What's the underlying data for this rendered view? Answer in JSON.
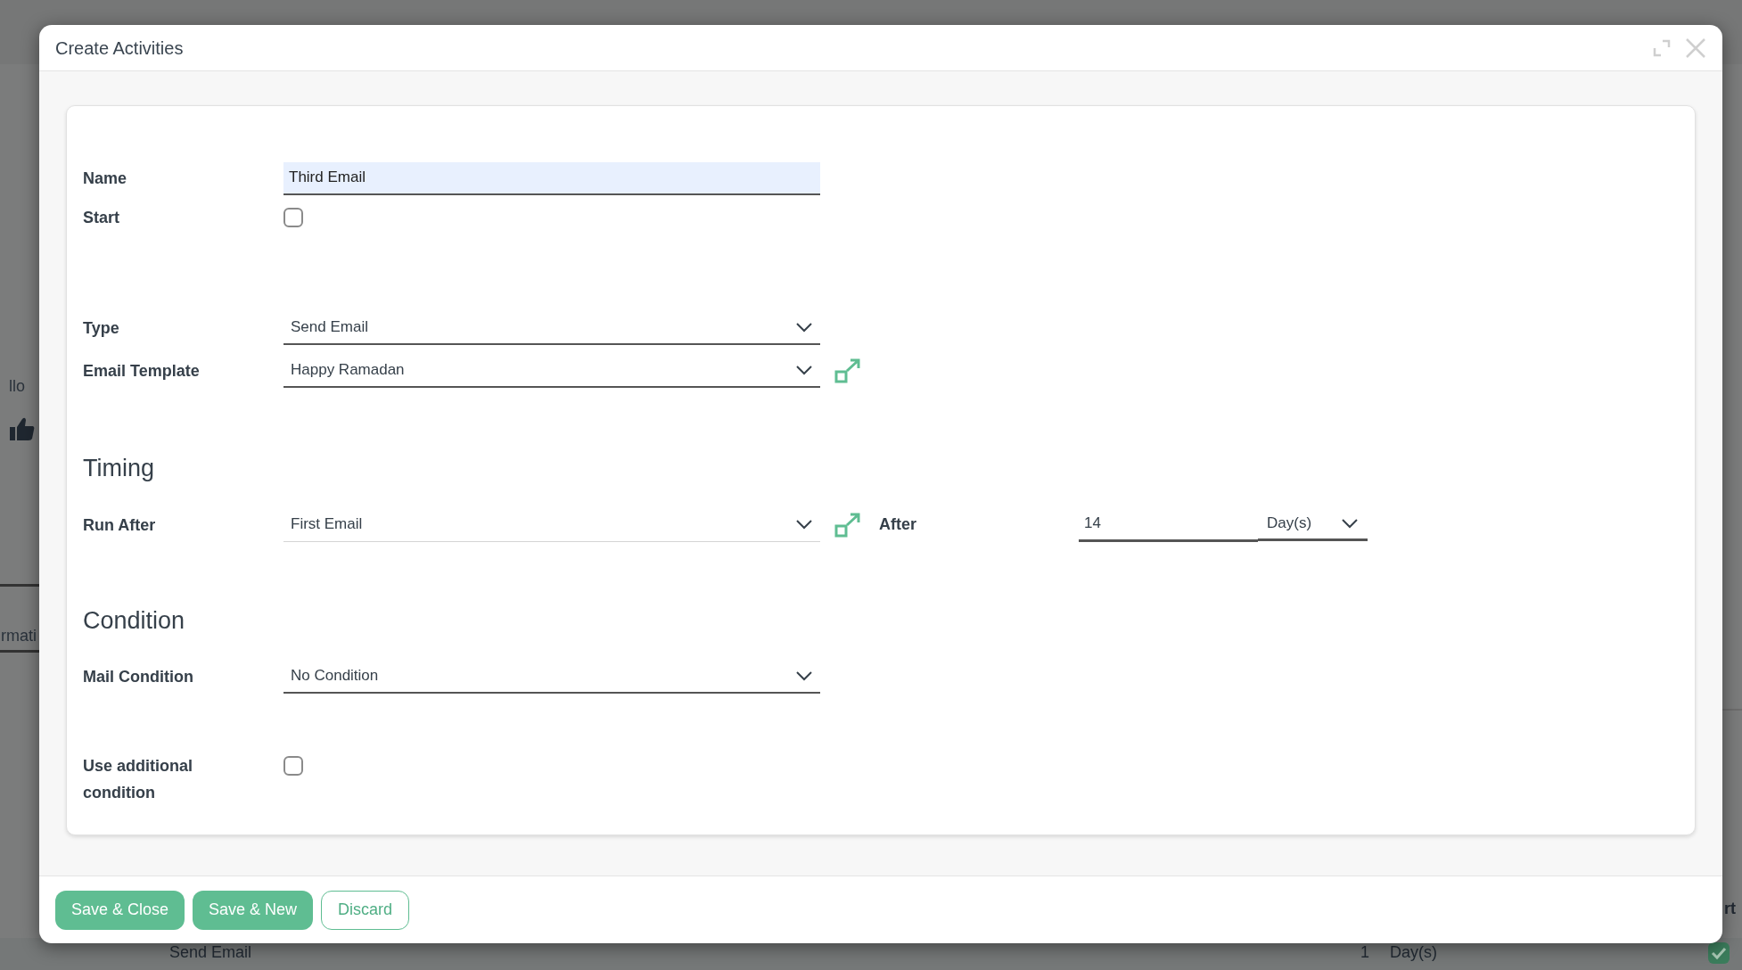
{
  "background": {
    "left_texts": [
      "llo",
      "rmati"
    ],
    "row": {
      "name": "Send Email",
      "count": "1",
      "unit": "Day(s)"
    },
    "right_text": "rt"
  },
  "dialog": {
    "title": "Create Activities"
  },
  "groups": [
    {
      "rows": [
        {
          "kind": "text",
          "label": "Name",
          "value": "Third Email"
        },
        {
          "kind": "checkbox",
          "label": "Start",
          "checked": false
        }
      ]
    },
    {
      "rows": [
        {
          "kind": "select",
          "label": "Type",
          "value": "Send Email",
          "link": false
        },
        {
          "kind": "select",
          "label": "Email Template",
          "value": "Happy Ramadan",
          "link": true
        }
      ]
    },
    {
      "heading": "Timing",
      "rows": [
        {
          "kind": "select_after",
          "label": "Run After",
          "value": "First Email",
          "link": true,
          "after_label": "After",
          "amount": "14",
          "unit": "Day(s)"
        }
      ]
    },
    {
      "heading": "Condition",
      "rows": [
        {
          "kind": "select",
          "label": "Mail Condition",
          "value": "No Condition",
          "link": false
        }
      ]
    },
    {
      "rows": [
        {
          "kind": "checkbox",
          "label": "Use additional condition",
          "checked": false
        }
      ]
    }
  ],
  "buttons": [
    {
      "label": "Save & Close",
      "primary": true
    },
    {
      "label": "Save & New",
      "primary": true
    },
    {
      "label": "Discard",
      "primary": false
    }
  ]
}
